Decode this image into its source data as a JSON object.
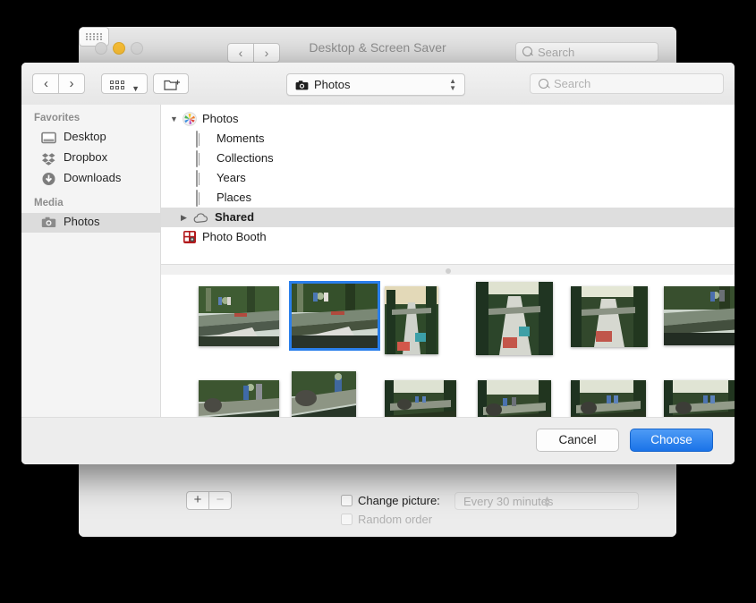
{
  "prefs_window": {
    "title": "Desktop & Screen Saver",
    "traffic_lights": {
      "close": "close-button",
      "minimize": "minimize-button",
      "zoom": "zoom-button"
    },
    "back_label": "‹",
    "forward_label": "›",
    "grid_label": "show-all-button",
    "search_placeholder": "Search",
    "add_label": "+",
    "remove_label": "−",
    "change_picture_label": "Change picture:",
    "random_order_label": "Random order",
    "interval_value": "Every 30 minutes",
    "help_label": "?"
  },
  "sheet": {
    "back_label": "‹",
    "forward_label": "›",
    "view_label": "view-options",
    "view_chevron": "∨",
    "new_folder_label": "new-folder",
    "location_label": "Photos",
    "location_chevrons": "⌃⌄",
    "search_placeholder": "Search",
    "cancel_label": "Cancel",
    "choose_label": "Choose",
    "accent_color": "#1a73e8",
    "selection_color": "#2a7fec"
  },
  "sidebar": {
    "sections": [
      {
        "title": "Favorites",
        "items": [
          {
            "label": "Desktop",
            "icon": "desktop-icon"
          },
          {
            "label": "Dropbox",
            "icon": "dropbox-icon"
          },
          {
            "label": "Downloads",
            "icon": "downloads-icon"
          }
        ]
      },
      {
        "title": "Media",
        "items": [
          {
            "label": "Photos",
            "icon": "camera-icon",
            "selected": true
          }
        ]
      }
    ]
  },
  "file_list": {
    "rows": [
      {
        "label": "Photos",
        "icon": "photos-app-icon",
        "indent": 0,
        "disclosure": "expanded",
        "selected": false
      },
      {
        "label": "Moments",
        "icon": "album-icon",
        "indent": 1,
        "disclosure": "none",
        "selected": false
      },
      {
        "label": "Collections",
        "icon": "album-icon",
        "indent": 1,
        "disclosure": "none",
        "selected": false
      },
      {
        "label": "Years",
        "icon": "album-icon",
        "indent": 1,
        "disclosure": "none",
        "selected": false
      },
      {
        "label": "Places",
        "icon": "album-icon",
        "indent": 1,
        "disclosure": "none",
        "selected": false
      },
      {
        "label": "Shared",
        "icon": "cloud-icon",
        "indent": 1,
        "disclosure": "collapsed",
        "selected": true
      },
      {
        "label": "Photo Booth",
        "icon": "photo-booth-icon",
        "indent": 0,
        "disclosure": "none",
        "selected": false
      }
    ]
  },
  "thumbnails": {
    "items": [
      {
        "name": "thumb-1",
        "selected": false
      },
      {
        "name": "thumb-2",
        "selected": true
      },
      {
        "name": "thumb-3",
        "selected": false
      },
      {
        "name": "thumb-4",
        "selected": false
      },
      {
        "name": "thumb-5",
        "selected": false
      },
      {
        "name": "thumb-6",
        "selected": false
      },
      {
        "name": "thumb-7",
        "selected": false
      },
      {
        "name": "thumb-8",
        "selected": false
      },
      {
        "name": "thumb-9",
        "selected": false
      },
      {
        "name": "thumb-10",
        "selected": false
      },
      {
        "name": "thumb-11",
        "selected": false
      },
      {
        "name": "thumb-12",
        "selected": false
      }
    ]
  }
}
